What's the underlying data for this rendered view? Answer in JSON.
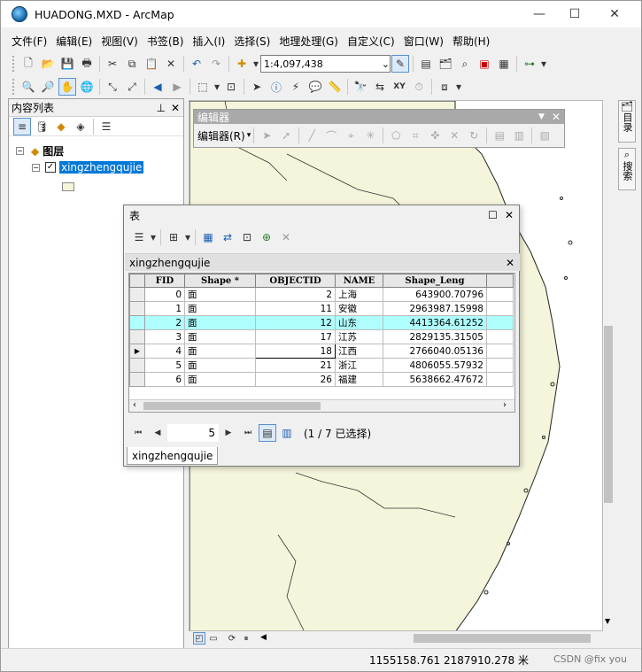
{
  "window": {
    "title": "HUADONG.MXD - ArcMap"
  },
  "menu": [
    "文件(F)",
    "编辑(E)",
    "视图(V)",
    "书签(B)",
    "插入(I)",
    "选择(S)",
    "地理处理(G)",
    "自定义(C)",
    "窗口(W)",
    "帮助(H)"
  ],
  "toolbar": {
    "scale_value": "1:4,097,438"
  },
  "toc": {
    "title": "内容列表",
    "layers_group": "图层",
    "layer_name": "xingzhengqujie"
  },
  "editor": {
    "title": "编辑器",
    "menu_label": "编辑器(R)"
  },
  "right_dock": {
    "catalog": "目录",
    "search": "搜索"
  },
  "attribute_table": {
    "title": "表",
    "layer_tab": "xingzhengqujie",
    "columns": [
      "FID",
      "Shape *",
      "OBJECTID",
      "NAME",
      "Shape_Leng"
    ],
    "rows": [
      [
        "0",
        "面",
        "2",
        "上海",
        "643900.70796"
      ],
      [
        "1",
        "面",
        "11",
        "安徽",
        "2963987.15998"
      ],
      [
        "2",
        "面",
        "12",
        "山东",
        "4413364.61252"
      ],
      [
        "3",
        "面",
        "17",
        "江苏",
        "2829135.31505"
      ],
      [
        "4",
        "面",
        "18",
        "江西",
        "2766040.05136"
      ],
      [
        "5",
        "面",
        "21",
        "浙江",
        "4806055.57932"
      ],
      [
        "6",
        "面",
        "26",
        "福建",
        "5638662.47672"
      ]
    ],
    "selected_row": 2,
    "current_row": 4,
    "record_number": "5",
    "selection_status": "(1 / 7 已选择)",
    "bottom_tab": "xingzhengqujie"
  },
  "status": {
    "coordinates": "1155158.761  2187910.278 米",
    "watermark": "CSDN @fix you"
  },
  "colors": {
    "land": "#f5f5dc",
    "selection": "#aefefe",
    "highlight": "#0078d7"
  }
}
